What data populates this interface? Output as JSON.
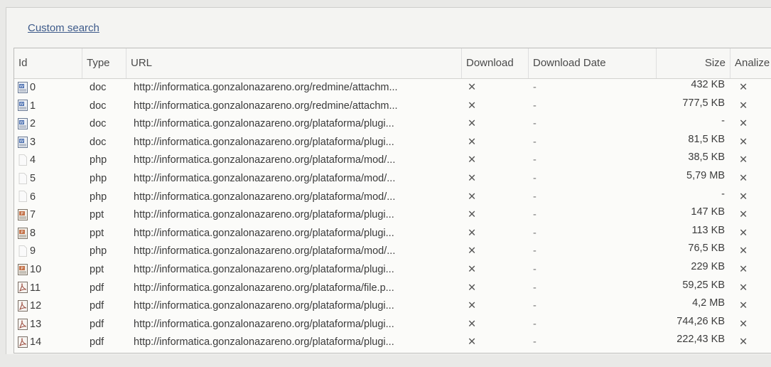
{
  "search": {
    "link_label": "Custom search"
  },
  "columns": {
    "id": "Id",
    "type": "Type",
    "url": "URL",
    "download": "Download",
    "download_date": "Download Date",
    "size": "Size",
    "analize": "Analize"
  },
  "rows": [
    {
      "id": "0",
      "type": "doc",
      "icon": "word-document-icon",
      "url": "http://informatica.gonzalonazareno.org/redmine/attachm...",
      "download": "✕",
      "date": "-",
      "size": "432 KB",
      "analize": "✕"
    },
    {
      "id": "1",
      "type": "doc",
      "icon": "word-document-icon",
      "url": "http://informatica.gonzalonazareno.org/redmine/attachm...",
      "download": "✕",
      "date": "-",
      "size": "777,5 KB",
      "analize": "✕"
    },
    {
      "id": "2",
      "type": "doc",
      "icon": "word-document-icon",
      "url": "http://informatica.gonzalonazareno.org/plataforma/plugi...",
      "download": "✕",
      "date": "-",
      "size": "-",
      "analize": "✕"
    },
    {
      "id": "3",
      "type": "doc",
      "icon": "word-document-icon",
      "url": "http://informatica.gonzalonazareno.org/plataforma/plugi...",
      "download": "✕",
      "date": "-",
      "size": "81,5 KB",
      "analize": "✕"
    },
    {
      "id": "4",
      "type": "php",
      "icon": "generic-file-icon",
      "url": "http://informatica.gonzalonazareno.org/plataforma/mod/...",
      "download": "✕",
      "date": "-",
      "size": "38,5 KB",
      "analize": "✕"
    },
    {
      "id": "5",
      "type": "php",
      "icon": "generic-file-icon",
      "url": "http://informatica.gonzalonazareno.org/plataforma/mod/...",
      "download": "✕",
      "date": "-",
      "size": "5,79 MB",
      "analize": "✕"
    },
    {
      "id": "6",
      "type": "php",
      "icon": "generic-file-icon",
      "url": "http://informatica.gonzalonazareno.org/plataforma/mod/...",
      "download": "✕",
      "date": "-",
      "size": "-",
      "analize": "✕"
    },
    {
      "id": "7",
      "type": "ppt",
      "icon": "powerpoint-icon",
      "url": "http://informatica.gonzalonazareno.org/plataforma/plugi...",
      "download": "✕",
      "date": "-",
      "size": "147 KB",
      "analize": "✕"
    },
    {
      "id": "8",
      "type": "ppt",
      "icon": "powerpoint-icon",
      "url": "http://informatica.gonzalonazareno.org/plataforma/plugi...",
      "download": "✕",
      "date": "-",
      "size": "113 KB",
      "analize": "✕"
    },
    {
      "id": "9",
      "type": "php",
      "icon": "generic-file-icon",
      "url": "http://informatica.gonzalonazareno.org/plataforma/mod/...",
      "download": "✕",
      "date": "-",
      "size": "76,5 KB",
      "analize": "✕"
    },
    {
      "id": "10",
      "type": "ppt",
      "icon": "powerpoint-icon",
      "url": "http://informatica.gonzalonazareno.org/plataforma/plugi...",
      "download": "✕",
      "date": "-",
      "size": "229 KB",
      "analize": "✕"
    },
    {
      "id": "11",
      "type": "pdf",
      "icon": "pdf-icon",
      "url": "http://informatica.gonzalonazareno.org/plataforma/file.p...",
      "download": "✕",
      "date": "-",
      "size": "59,25 KB",
      "analize": "✕"
    },
    {
      "id": "12",
      "type": "pdf",
      "icon": "pdf-icon",
      "url": "http://informatica.gonzalonazareno.org/plataforma/plugi...",
      "download": "✕",
      "date": "-",
      "size": "4,2 MB",
      "analize": "✕"
    },
    {
      "id": "13",
      "type": "pdf",
      "icon": "pdf-icon",
      "url": "http://informatica.gonzalonazareno.org/plataforma/plugi...",
      "download": "✕",
      "date": "-",
      "size": "744,26 KB",
      "analize": "✕"
    },
    {
      "id": "14",
      "type": "pdf",
      "icon": "pdf-icon",
      "url": "http://informatica.gonzalonazareno.org/plataforma/plugi...",
      "download": "✕",
      "date": "-",
      "size": "222,43 KB",
      "analize": "✕"
    }
  ]
}
